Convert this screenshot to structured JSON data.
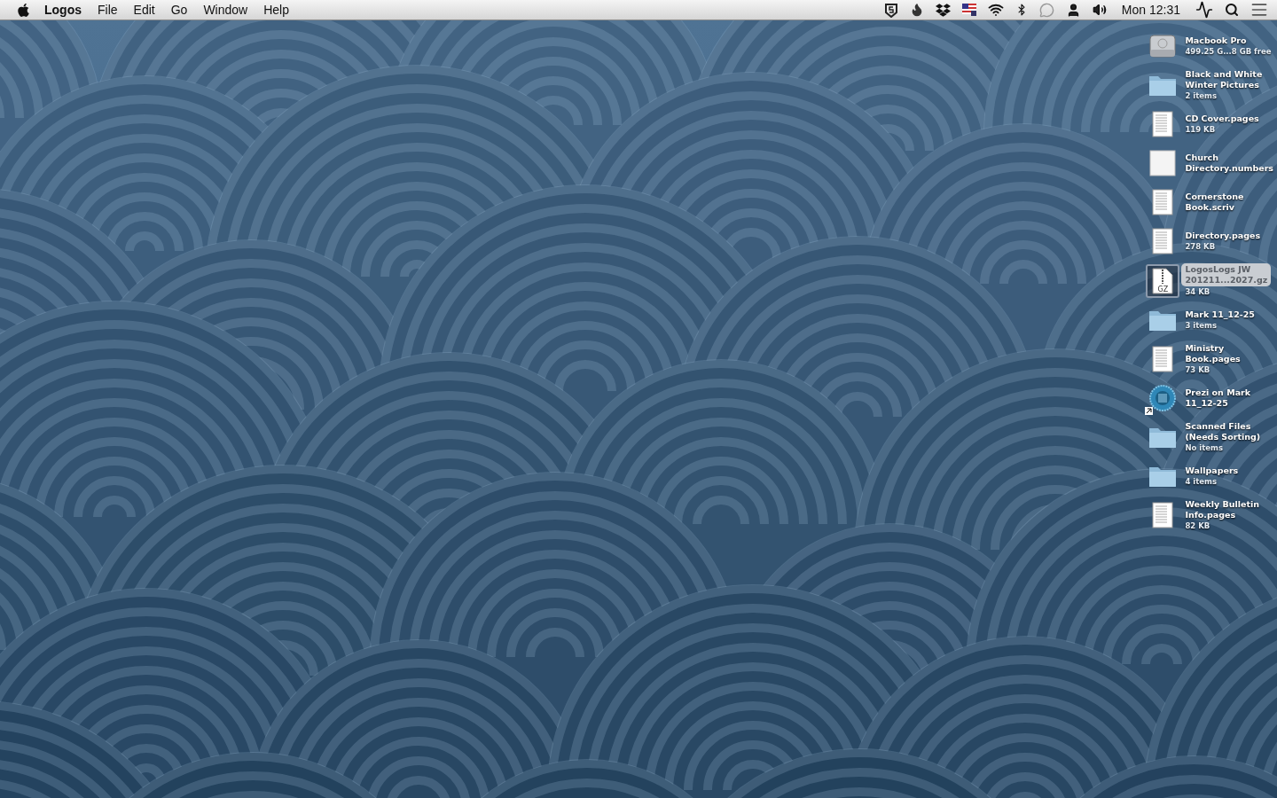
{
  "menu_bar": {
    "app_name": "Logos",
    "menus": [
      "File",
      "Edit",
      "Go",
      "Window",
      "Help"
    ],
    "clock": "Mon 12:31"
  },
  "desktop_items": [
    {
      "kind": "drive",
      "name": [
        "Macbook Pro"
      ],
      "info": "499.25 G...8 GB free",
      "selected": false
    },
    {
      "kind": "folder",
      "name": [
        "Black and White",
        "Winter Pictures"
      ],
      "info": "2 items",
      "selected": false
    },
    {
      "kind": "document",
      "name": [
        "CD Cover.pages"
      ],
      "info": "119 KB",
      "selected": false
    },
    {
      "kind": "blank",
      "name": [
        "Church",
        "Directory.numbers"
      ],
      "selected": false
    },
    {
      "kind": "document",
      "name": [
        "Cornerstone",
        "Book.scriv"
      ],
      "selected": false
    },
    {
      "kind": "document",
      "name": [
        "Directory.pages"
      ],
      "info": "278 KB",
      "selected": false
    },
    {
      "kind": "archive",
      "name": [
        "LogosLogs JW",
        "201211...2027.gz"
      ],
      "info": "34 KB",
      "badge": "GZ",
      "selected": true
    },
    {
      "kind": "folder",
      "name": [
        "Mark 11_12-25"
      ],
      "info": "3 items",
      "selected": false
    },
    {
      "kind": "document",
      "name": [
        "Ministry",
        "Book.pages"
      ],
      "info": "73 KB",
      "selected": false
    },
    {
      "kind": "app",
      "name": [
        "Prezi on Mark",
        "11_12-25"
      ],
      "alias": true,
      "selected": false
    },
    {
      "kind": "folder",
      "name": [
        "Scanned Files",
        "(Needs Sorting)"
      ],
      "info": "No items",
      "selected": false
    },
    {
      "kind": "folder",
      "name": [
        "Wallpapers"
      ],
      "info": "4 items",
      "selected": false
    },
    {
      "kind": "document",
      "name": [
        "Weekly Bulletin",
        "Info.pages"
      ],
      "info": "82 KB",
      "selected": false
    }
  ]
}
